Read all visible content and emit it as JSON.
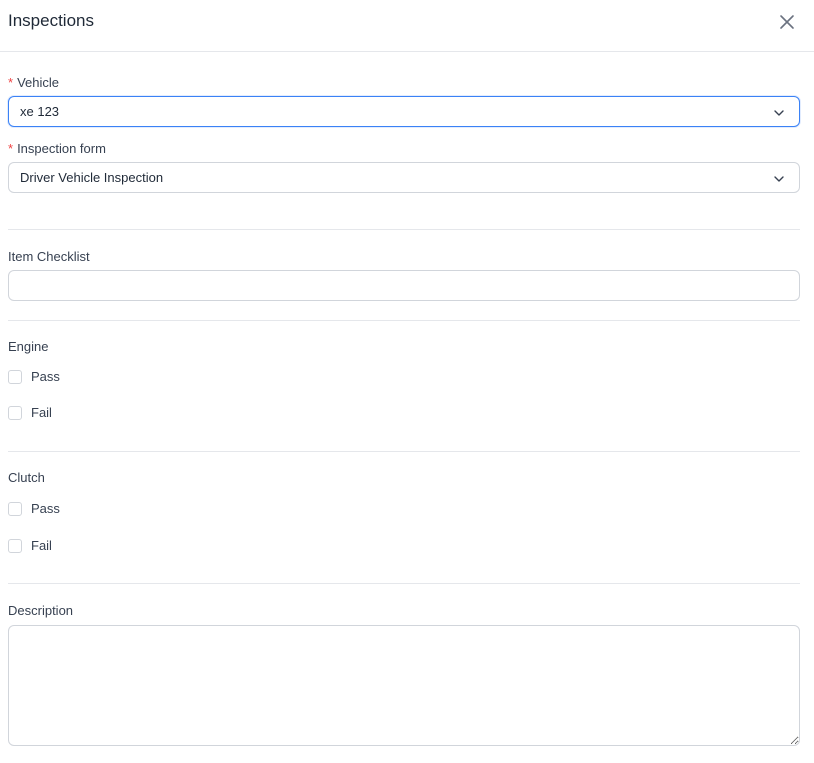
{
  "dialog": {
    "title": "Inspections",
    "close_icon": "close-icon"
  },
  "vehicle": {
    "required_mark": "*",
    "label": "Vehicle",
    "value": "xe 123",
    "icon": "chevron-down-icon"
  },
  "inspection_form": {
    "required_mark": "*",
    "label": "Inspection form",
    "value": "Driver Vehicle Inspection",
    "icon": "chevron-down-icon"
  },
  "item_checklist": {
    "label": "Item Checklist",
    "value": ""
  },
  "engine": {
    "label": "Engine",
    "options": [
      {
        "label": "Pass",
        "checked": false
      },
      {
        "label": "Fail",
        "checked": false
      }
    ]
  },
  "clutch": {
    "label": "Clutch",
    "options": [
      {
        "label": "Pass",
        "checked": false
      },
      {
        "label": "Fail",
        "checked": false
      }
    ]
  },
  "description": {
    "label": "Description",
    "value": ""
  },
  "colors": {
    "focus_border": "#3b82f6",
    "required": "#ef4444",
    "border": "#d1d5db",
    "divider": "#e5e7eb"
  }
}
